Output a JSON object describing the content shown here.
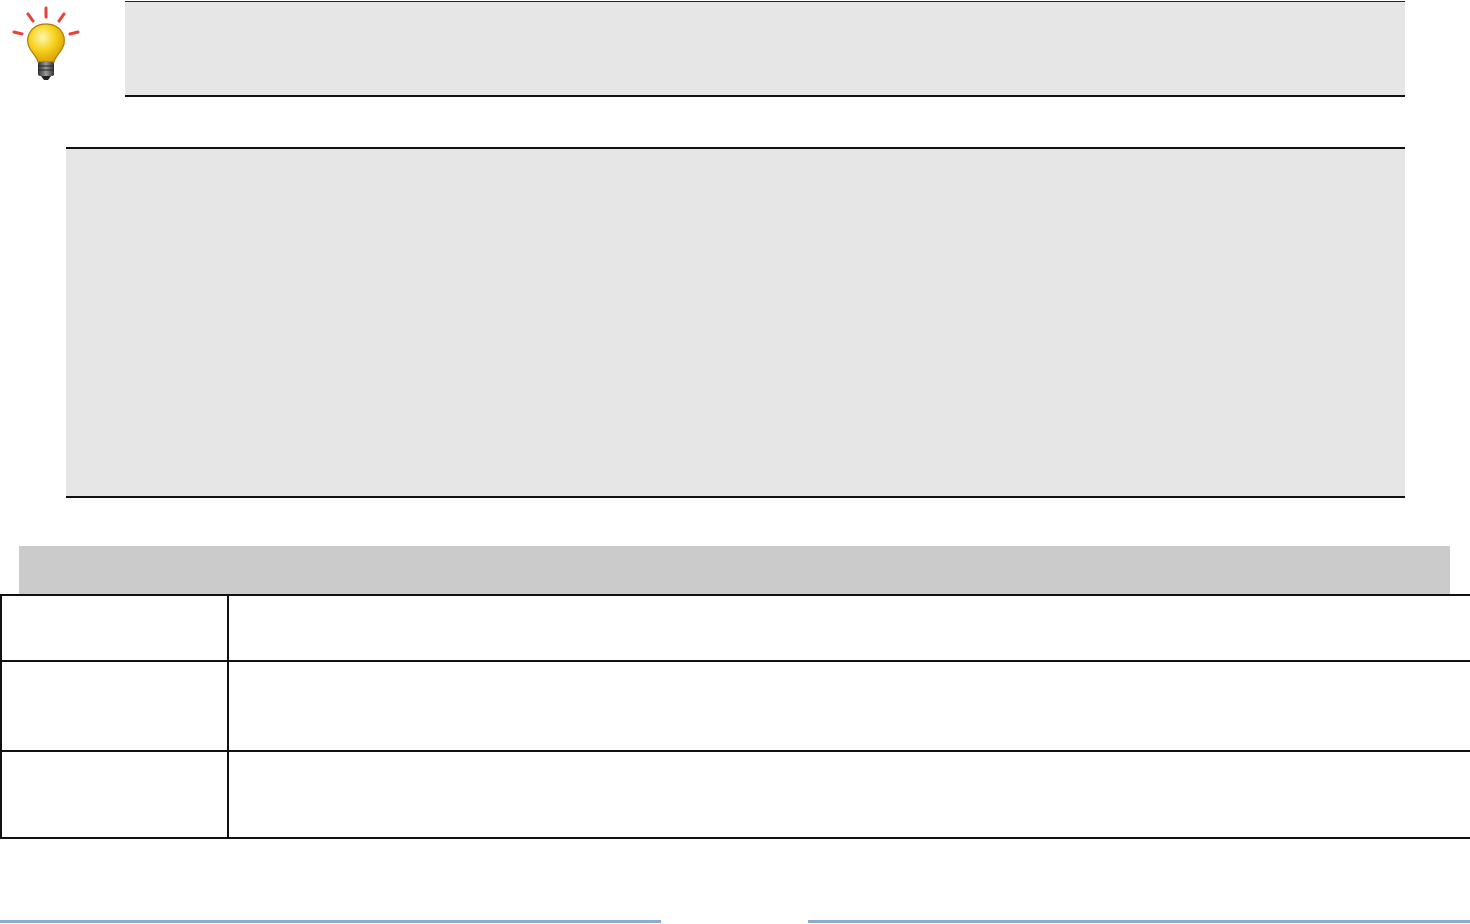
{
  "tip": {
    "icon": "lightbulb-icon",
    "text": ""
  },
  "note": {
    "text": ""
  },
  "table": {
    "header": "",
    "rows": [
      {
        "label": "",
        "value": ""
      },
      {
        "label": "",
        "value": ""
      },
      {
        "label": "",
        "value": ""
      }
    ]
  },
  "colors": {
    "panel_bg": "#e6e6e6",
    "header_bg": "#cbcbcb",
    "footer_rule": "#8ea9d2",
    "bulb_yellow": "#f5d21c",
    "rays_red": "#e8413a"
  }
}
